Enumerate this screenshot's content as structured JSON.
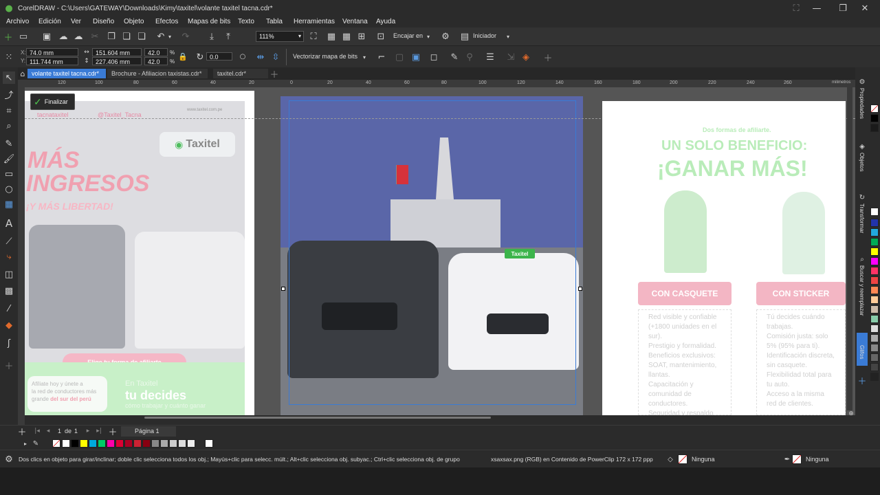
{
  "app": {
    "title": "CorelDRAW - C:\\Users\\GATEWAY\\Downloads\\Kimy\\taxitel\\volante taxitel tacna.cdr*"
  },
  "menu": [
    "Archivo",
    "Edición",
    "Ver",
    "Diseño",
    "Objeto",
    "Efectos",
    "Mapas de bits",
    "Texto",
    "Tabla",
    "Herramientas",
    "Ventana",
    "Ayuda"
  ],
  "toolbar": {
    "zoom": "111%",
    "snap_label": "Encajar en",
    "launch_label": "Iniciador"
  },
  "props": {
    "x": "74.0 mm",
    "y": "111.744 mm",
    "w": "151.604 mm",
    "h": "227.406 mm",
    "sx": "42.0",
    "sy": "42.0",
    "pct": "%",
    "angle": "0.0",
    "trace_label": "Vectorizar mapa de bits"
  },
  "tabs": [
    {
      "label": "volante taxitel tacna.cdr*"
    },
    {
      "label": "Brochure - Afiliacion taxistas.cdr*"
    },
    {
      "label": "taxitel.cdr*"
    }
  ],
  "ruler": {
    "unit": "milimetros",
    "ticks": [
      "120",
      "100",
      "80",
      "60",
      "40",
      "20",
      "0",
      "20",
      "40",
      "60",
      "80",
      "100",
      "120",
      "140",
      "160",
      "180",
      "200",
      "220",
      "240",
      "260",
      "280",
      "300"
    ]
  },
  "canvas": {
    "finish_label": "Finalizar",
    "left_page": {
      "tag1": "tacnataxitel",
      "tag2": "@Taxitel_Tacna",
      "web": "www.taxitel.com.pe",
      "logo": "Taxitel",
      "headline1": "MÁS",
      "headline2": "INGRESOS",
      "headline3": "¡Y MÁS LIBERTAD!",
      "cta": "Elige tu forma de afiliarte",
      "foot1": "Afíliate hoy y únete a",
      "foot2": "la red de conductores más",
      "foot3": "grande",
      "foot4": "del sur del perú",
      "foot_right1": "En Taxitel",
      "foot_right2": "tu decides",
      "foot_right3": "cómo trabajar y cuánto ganar"
    },
    "center_badge": "Taxitel",
    "right_page": {
      "kicker": "Dos formas de afiliarte.",
      "title1": "UN SOLO BENEFICIO:",
      "title2": "¡GANAR MÁS!",
      "btn1": "CON CASQUETE",
      "btn2": "CON STICKER",
      "list1": [
        "Red visible y confiable (+1800 unidades en el sur).",
        "Prestigio y formalidad.",
        "Beneficios exclusivos: SOAT, mantenimiento, llantas.",
        "Capacitación y comunidad de conductores.",
        "Seguridad y respaldo de"
      ],
      "list2": [
        "Tú decides cuándo trabajas.",
        "Comisión justa: solo 5% (95% para ti).",
        "Identificación discreta, sin casquete.",
        "Flexibilidad total para tu auto.",
        "Acceso a la misma red de clientes."
      ]
    }
  },
  "right_dock": [
    "Propiedades",
    "Objetos",
    "Transformar",
    "Buscar y reemplazar",
    "Glifos"
  ],
  "page_nav": {
    "page": "1",
    "of": "de",
    "total": "1",
    "tab": "Página 1"
  },
  "status": {
    "hint": "Dos clics en objeto para girar/inclinar; doble clic selecciona todos los obj.; Mayús+clic para selecc. múlt.; Alt+clic selecciona obj. subyac.; Ctrl+clic selecciona obj. de grupo",
    "object": "xsaxsax.png (RGB) en Contenido de PowerClip  172 x 172 ppp",
    "fill": "Ninguna",
    "outline": "Ninguna"
  },
  "colors": {
    "accent": "#3a7bd5",
    "brand_green": "#3cb44b",
    "pink": "#e8456b"
  },
  "palette_colors": [
    "#ffffff",
    "#000000",
    "#1a1a1a",
    "#ffffff",
    "#2233aa",
    "#3355ff",
    "#22aadd",
    "#00aa55",
    "#ffff00",
    "#ff00ff",
    "#ff3366",
    "#ee4444",
    "#ff8855",
    "#ffcc99",
    "#ccbbaa",
    "#88ccaa",
    "#dddddd",
    "#aaaaaa",
    "#888888",
    "#666666",
    "#444444",
    "#222222"
  ],
  "bottom_colors": [
    "#ffffff",
    "#000000",
    "#ffff00",
    "#00aadd",
    "#00cc66",
    "#ff00aa",
    "#dd0033",
    "#aa0022",
    "#cc2233",
    "#880011",
    "#888888",
    "#aaaaaa",
    "#cccccc",
    "#dddddd",
    "#ffffff"
  ]
}
